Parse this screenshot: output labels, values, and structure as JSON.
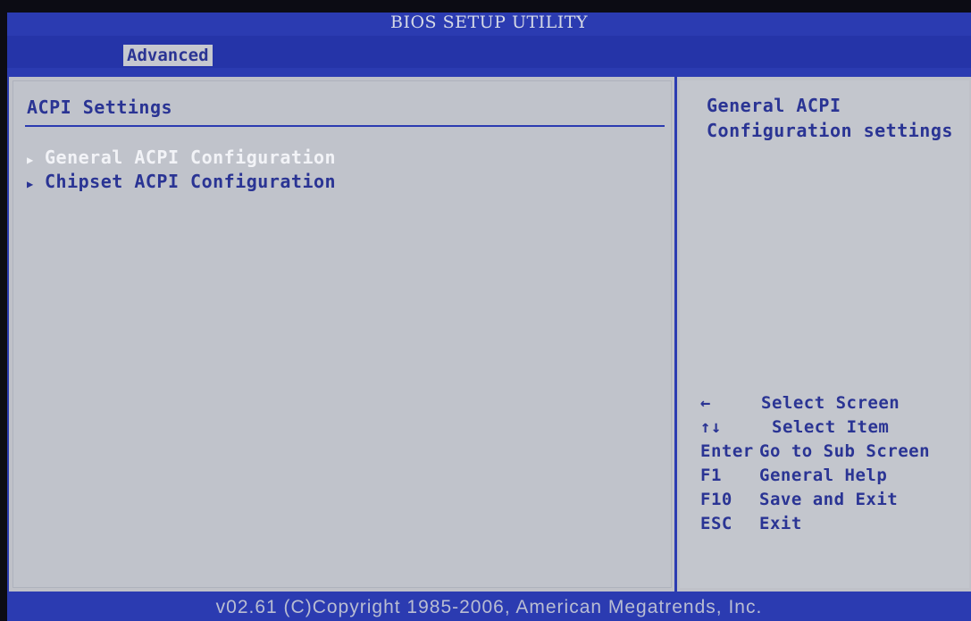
{
  "window": {
    "title": "BIOS SETUP UTILITY"
  },
  "menu": {
    "tabs": [
      {
        "label": "Advanced"
      }
    ]
  },
  "main": {
    "section_title": "ACPI Settings",
    "items": [
      {
        "label": "General ACPI Configuration",
        "selected": true
      },
      {
        "label": "Chipset ACPI Configuration",
        "selected": false
      }
    ]
  },
  "help": {
    "title_line1": "General ACPI",
    "title_line2": "Configuration settings"
  },
  "keys": [
    {
      "key": "←",
      "action": "Select Screen"
    },
    {
      "key": "↑↓",
      "action": "Select Item"
    },
    {
      "key": "Enter",
      "action": "Go to Sub Screen"
    },
    {
      "key": "F1",
      "action": "General Help"
    },
    {
      "key": "F10",
      "action": "Save and Exit"
    },
    {
      "key": "ESC",
      "action": "Exit"
    }
  ],
  "footer": {
    "text": "v02.61 (C)Copyright 1985-2006, American Megatrends, Inc."
  },
  "colors": {
    "frame_blue": "#2b3bb1",
    "panel_gray": "#c0c3cb",
    "text_blue": "#2a3494",
    "highlight_white": "#f2f3f7"
  },
  "icons": {
    "submenu_arrow": "triangle-right-icon"
  }
}
